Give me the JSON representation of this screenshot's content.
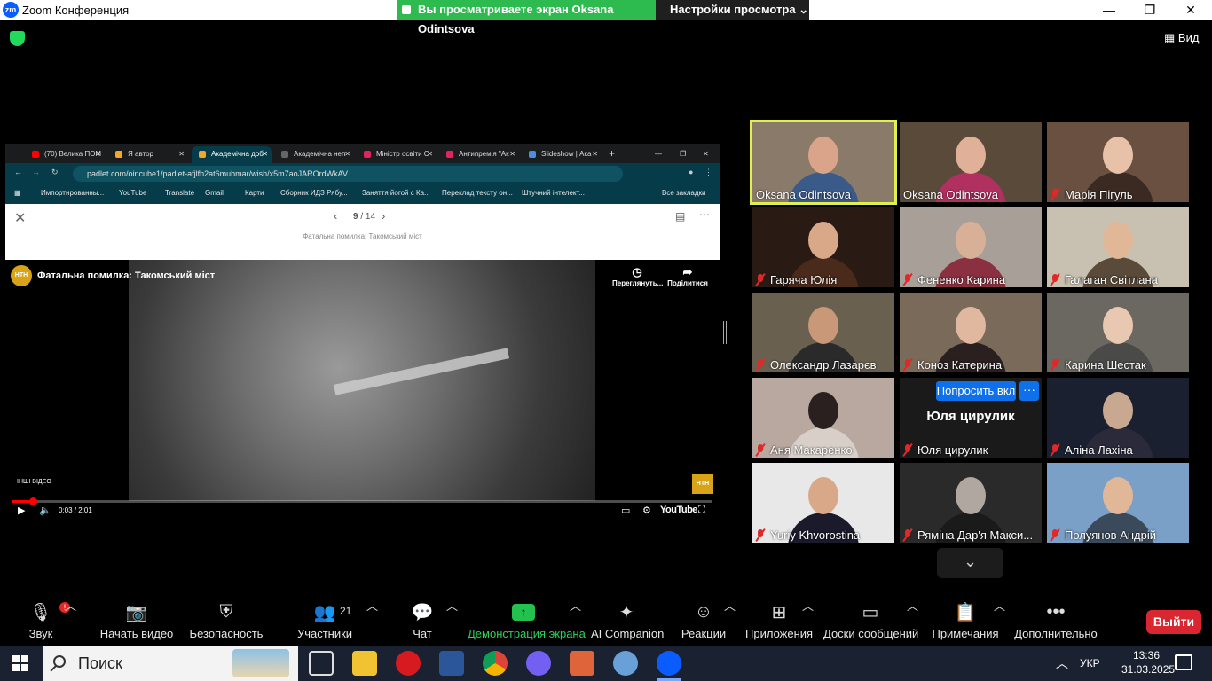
{
  "window": {
    "logo_text": "zm",
    "title": "Zoom Конференция",
    "minimize": "—",
    "restore": "❐",
    "close": "✕"
  },
  "share_banner": {
    "viewing_text": "Вы просматриваете экран Oksana Odintsova",
    "view_settings": "Настройки просмотра ⌄"
  },
  "view_button": "Вид",
  "browser": {
    "tabs": [
      {
        "label": "(70) Велика ПОМ",
        "color": "#ff0000"
      },
      {
        "label": "Я автор",
        "color": "#f4a62a"
      },
      {
        "label": "Академічна доб",
        "color": "#f4a62a"
      },
      {
        "label": "Академічна неп",
        "color": "#666666"
      },
      {
        "label": "Міністр освіти С",
        "color": "#e0245e"
      },
      {
        "label": "Антипремія \"Ак",
        "color": "#e0245e"
      },
      {
        "label": "Slideshow | Ака",
        "color": "#4a90e2"
      }
    ],
    "url": "padlet.com/oincube1/padlet-afjlfh2at6muhmar/wish/x5m7aoJAROrdWkAV",
    "bookmarks": [
      "Импортированны...",
      "YouTube",
      "Translate",
      "Gmail",
      "Карти",
      "Сборник ИДЗ Рябу...",
      "Заняття йогой с Ка...",
      "Переклад тексту он...",
      "Штучний інтелект...",
      "Все закладки"
    ]
  },
  "padlet": {
    "counter_current": "9",
    "counter_total": "/ 14",
    "caption": "Фатальна помилка: Такомський міст"
  },
  "video": {
    "channel_logo": "НТН",
    "title": "Фатальна помилка: Такомський міст",
    "watch_later": "Переглянуть...",
    "share": "Поділитися",
    "more_videos": "ІНШІ ВІДЕО",
    "time": "0:03 / 2:01",
    "progress": 0.025,
    "youtube": "YouTube"
  },
  "participants": [
    {
      "name": "Oksana Odintsova",
      "muted": false,
      "active": true,
      "bg": "#8a7a6a",
      "skin": "#d9a48a",
      "cloth": "#3a5a8a"
    },
    {
      "name": "Oksana Odintsova",
      "muted": false,
      "active": false,
      "bg": "#5a4a3a",
      "skin": "#e0b098",
      "cloth": "#b03060"
    },
    {
      "name": "Марія Пігуль",
      "muted": true,
      "active": false,
      "bg": "#6a5040",
      "skin": "#e8c2a8",
      "cloth": "#3a2a22"
    },
    {
      "name": "Гаряча Юлія",
      "muted": true,
      "active": false,
      "bg": "#2a1a14",
      "skin": "#d8a888",
      "cloth": "#4a2a1a"
    },
    {
      "name": "Фененко Карина",
      "muted": true,
      "active": false,
      "bg": "#a8a098",
      "skin": "#d8b098",
      "cloth": "#8a3040"
    },
    {
      "name": "Галаган Світлана",
      "muted": true,
      "active": false,
      "bg": "#c8c0b0",
      "skin": "#e0b898",
      "cloth": "#5a4a3a"
    },
    {
      "name": "Олександр Лазарєв",
      "muted": true,
      "active": false,
      "bg": "#6a6050",
      "skin": "#c89878",
      "cloth": "#2a2a2a"
    },
    {
      "name": "Коноз Катерина",
      "muted": true,
      "active": false,
      "bg": "#7a6a5a",
      "skin": "#e0b8a0",
      "cloth": "#2a2020"
    },
    {
      "name": "Карина Шестак",
      "muted": true,
      "active": false,
      "bg": "#6a6860",
      "skin": "#e8c8b0",
      "cloth": "#4a4a48"
    },
    {
      "name": "Аня Макаренко",
      "muted": true,
      "active": false,
      "bg": "#b8a8a0",
      "skin": "#2a2020",
      "cloth": "#d8d0c8"
    },
    {
      "name": "Юля цирулик",
      "muted": true,
      "active": false,
      "bg": "#1a1a1a",
      "skin": "",
      "cloth": ""
    },
    {
      "name": "Аліна Лахіна",
      "muted": true,
      "active": false,
      "bg": "#1a2030",
      "skin": "#c8a890",
      "cloth": "#2a2a3a"
    },
    {
      "name": "Yuriy Khvorostina",
      "muted": true,
      "active": false,
      "bg": "#e8e8e8",
      "skin": "#d8a888",
      "cloth": "#1a1a2a"
    },
    {
      "name": "Ряміна Дар'я Макси...",
      "muted": true,
      "active": false,
      "bg": "#2a2a2a",
      "skin": "#b0a8a0",
      "cloth": "#1a1a1a"
    },
    {
      "name": "Полуянов Андрій",
      "muted": true,
      "active": false,
      "bg": "#7aa0c8",
      "skin": "#e0b898",
      "cloth": "#3a4a5a"
    }
  ],
  "no_video_tile": {
    "big_name": "Юля цирулик",
    "ask_to_enable": "Попросить вкл",
    "more": "···"
  },
  "gallery_next": "⌄",
  "toolbar": {
    "audio": "Звук",
    "audio_badge": "!",
    "video": "Начать видео",
    "security": "Безопасность",
    "participants": "Участники",
    "participants_count": "21",
    "chat": "Чат",
    "share": "Демонстрация экрана",
    "ai": "AI Companion",
    "reactions": "Реакции",
    "apps": "Приложения",
    "whiteboards": "Доски сообщений",
    "notes": "Примечания",
    "more": "Дополнительно",
    "leave": "Выйти"
  },
  "taskbar": {
    "search": "Поиск",
    "lang": "УКР",
    "time": "13:36",
    "date": "31.03.2025"
  }
}
